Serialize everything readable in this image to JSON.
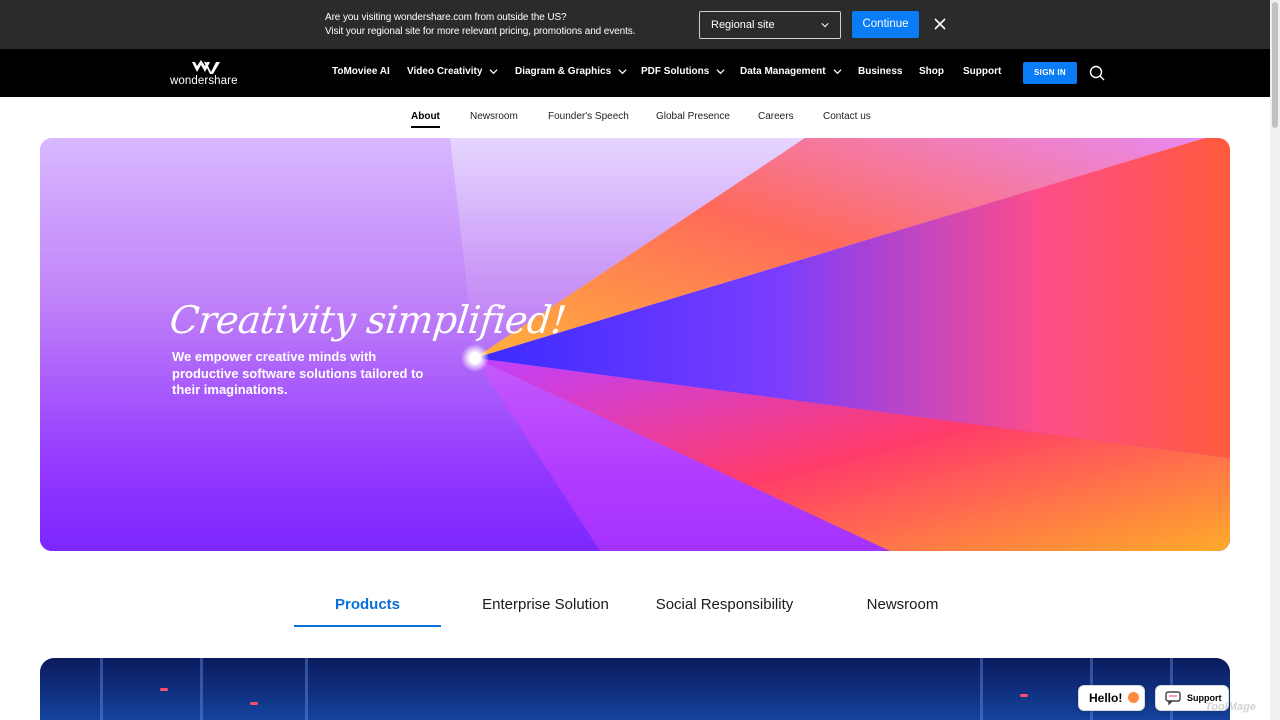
{
  "regional_banner": {
    "line1": "Are you visiting wondershare.com from outside the US?",
    "line2": "Visit your regional site for more relevant pricing, promotions and events.",
    "select_value": "Regional site",
    "continue_label": "Continue"
  },
  "header": {
    "logo_text": "wondershare",
    "nav": [
      {
        "label": "ToMoviee AI",
        "has_dropdown": false
      },
      {
        "label": "Video Creativity",
        "has_dropdown": true
      },
      {
        "label": "Diagram & Graphics",
        "has_dropdown": true
      },
      {
        "label": "PDF Solutions",
        "has_dropdown": true
      },
      {
        "label": "Data Management",
        "has_dropdown": true
      },
      {
        "label": "Business",
        "has_dropdown": false
      },
      {
        "label": "Shop",
        "has_dropdown": false
      },
      {
        "label": "Support",
        "has_dropdown": false
      }
    ],
    "signin_label": "SIGN IN"
  },
  "subnav": {
    "items": [
      "About",
      "Newsroom",
      "Founder's Speech",
      "Global Presence",
      "Careers",
      "Contact us"
    ],
    "active": "About"
  },
  "hero": {
    "title": "Creativity simplified!",
    "subtitle": "We empower creative minds with productive software solutions tailored to their imaginations."
  },
  "section_tabs": {
    "items": [
      "Products",
      "Enterprise Solution",
      "Social Responsibility",
      "Newsroom"
    ],
    "active": "Products"
  },
  "widgets": {
    "hello_label": "Hello!",
    "support_label": "Support",
    "watermark": "ToolMage"
  },
  "colors": {
    "accent_blue": "#0a7cf5",
    "tab_active": "#0a6fd6",
    "banner_bg": "#2b2b2b",
    "nav_bg": "#000000"
  }
}
